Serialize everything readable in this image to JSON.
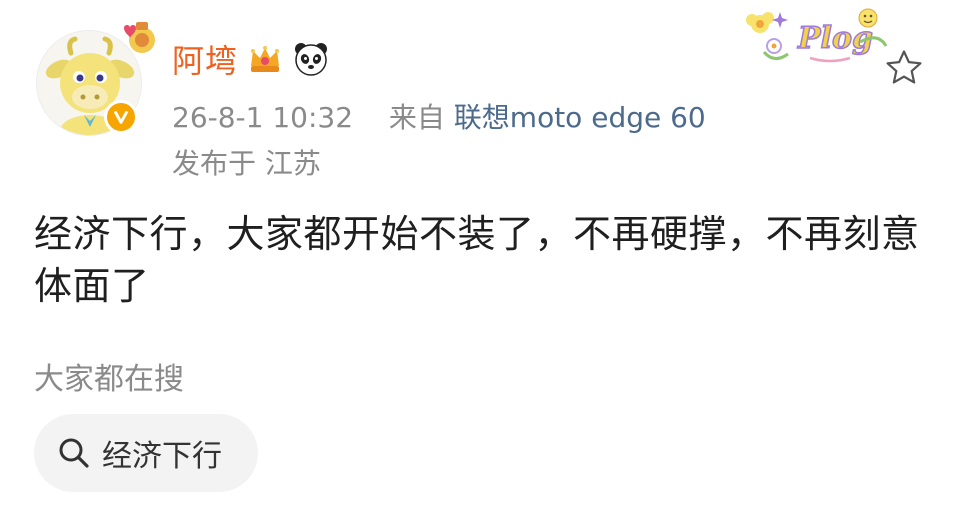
{
  "post": {
    "username": "阿塆",
    "timestamp": "26-8-1 10:32",
    "source_prefix": "来自",
    "source_device": "联想moto edge 60",
    "location": "发布于 江苏",
    "text": "经济下行，大家都开始不装了，不再硬撑，不再刻意体面了"
  },
  "search": {
    "section_label": "大家都在搜",
    "chip_label": "经济下行"
  },
  "badges": {
    "crown_icon": "crown-badge-icon",
    "panda_icon": "panda-badge-icon",
    "verified_icon": "verified-v-icon",
    "favorite_icon": "star-outline-icon",
    "search_icon": "magnifier-icon",
    "sticker_text": "Plog"
  },
  "colors": {
    "username": "#f0611f",
    "source_link": "#4c6a8c",
    "verified": "#f7a500",
    "meta_text": "#8a8a8a",
    "chip_background": "#f3f3f3"
  }
}
